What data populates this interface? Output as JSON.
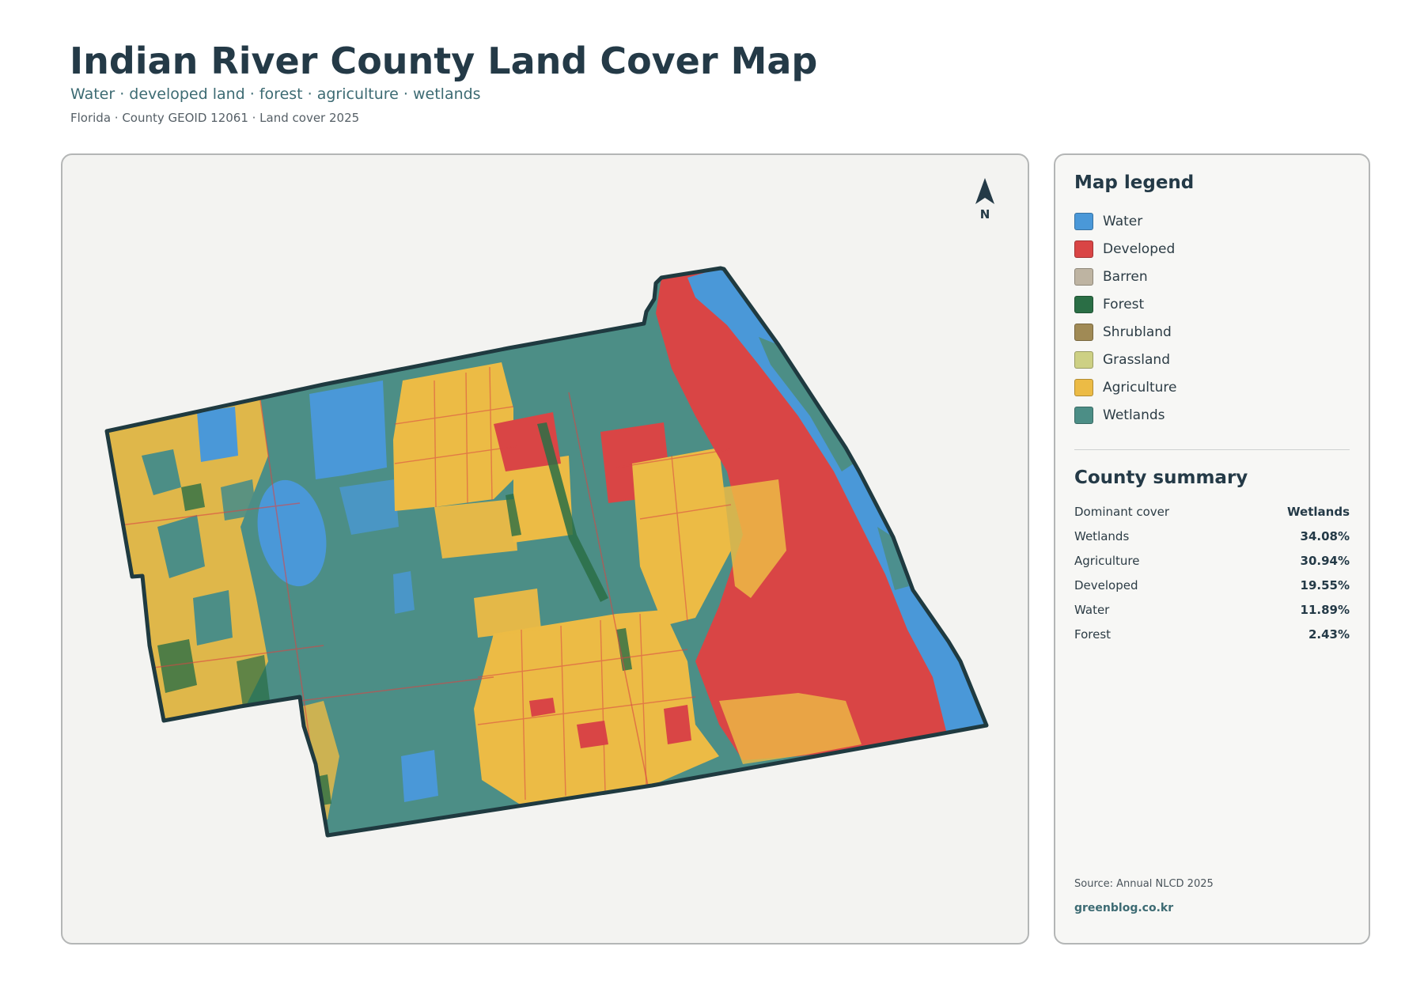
{
  "header": {
    "title": "Indian River County Land Cover Map",
    "subtitle": "Water · developed land · forest · agriculture · wetlands",
    "meta": "Florida · County GEOID 12061 · Land cover 2025"
  },
  "map": {
    "north_label": "N",
    "background_color": "#f3f3f1",
    "outline_color": "#1f3a40",
    "north_arrow_icon": "north-arrow-icon"
  },
  "legend": {
    "heading": "Map legend",
    "items": [
      {
        "label": "Water",
        "color": "#4a98d8"
      },
      {
        "label": "Developed",
        "color": "#d94545"
      },
      {
        "label": "Barren",
        "color": "#beb4a2"
      },
      {
        "label": "Forest",
        "color": "#2a6e45"
      },
      {
        "label": "Shrubland",
        "color": "#a08a55"
      },
      {
        "label": "Grassland",
        "color": "#cdd084"
      },
      {
        "label": "Agriculture",
        "color": "#ecbb45"
      },
      {
        "label": "Wetlands",
        "color": "#4c8e86"
      }
    ]
  },
  "summary": {
    "heading": "County summary",
    "rows": [
      {
        "label": "Dominant cover",
        "value": "Wetlands"
      },
      {
        "label": "Wetlands",
        "value": "34.08%"
      },
      {
        "label": "Agriculture",
        "value": "30.94%"
      },
      {
        "label": "Developed",
        "value": "19.55%"
      },
      {
        "label": "Water",
        "value": "11.89%"
      },
      {
        "label": "Forest",
        "value": "2.43%"
      }
    ]
  },
  "footer": {
    "source": "Source: Annual NLCD 2025",
    "site": "greenblog.co.kr"
  }
}
